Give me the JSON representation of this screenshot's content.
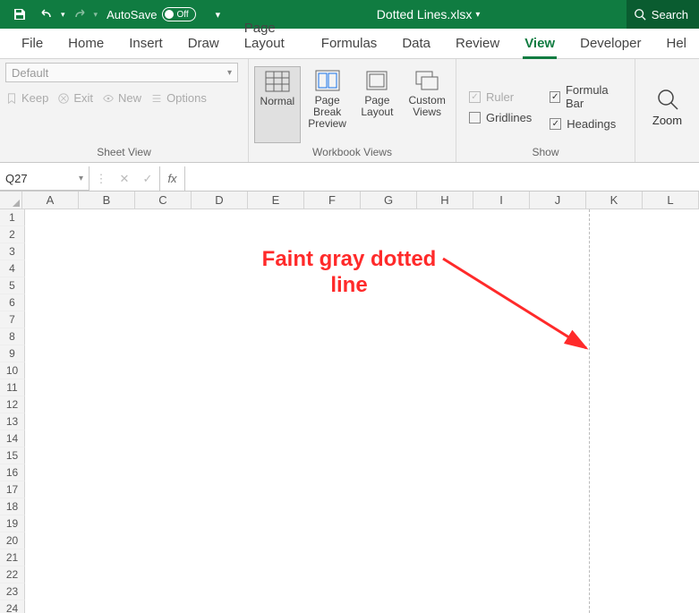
{
  "titlebar": {
    "autosave_label": "AutoSave",
    "autosave_state": "Off",
    "filename": "Dotted Lines.xlsx",
    "search_label": "Search"
  },
  "tabs": [
    "File",
    "Home",
    "Insert",
    "Draw",
    "Page Layout",
    "Formulas",
    "Data",
    "Review",
    "View",
    "Developer",
    "Hel"
  ],
  "active_tab": "View",
  "ribbon": {
    "sheet_view": {
      "default_label": "Default",
      "keep": "Keep",
      "exit": "Exit",
      "new": "New",
      "options": "Options",
      "group_label": "Sheet View"
    },
    "workbook_views": {
      "normal": "Normal",
      "page_break": "Page Break Preview",
      "page_layout": "Page Layout",
      "custom": "Custom Views",
      "group_label": "Workbook Views"
    },
    "show": {
      "ruler": "Ruler",
      "formula_bar": "Formula Bar",
      "gridlines": "Gridlines",
      "headings": "Headings",
      "group_label": "Show"
    },
    "zoom": {
      "label": "Zoom"
    }
  },
  "namebox": "Q27",
  "columns": [
    "A",
    "B",
    "C",
    "D",
    "E",
    "F",
    "G",
    "H",
    "I",
    "J",
    "K",
    "L"
  ],
  "rows": [
    1,
    2,
    3,
    4,
    5,
    6,
    7,
    8,
    9,
    10,
    11,
    12,
    13,
    14,
    15,
    16,
    17,
    18,
    19,
    20,
    21,
    22,
    23,
    24
  ],
  "page_break_after_col_index": 9,
  "annotation": {
    "text_line1": "Faint gray dotted",
    "text_line2": "line"
  }
}
